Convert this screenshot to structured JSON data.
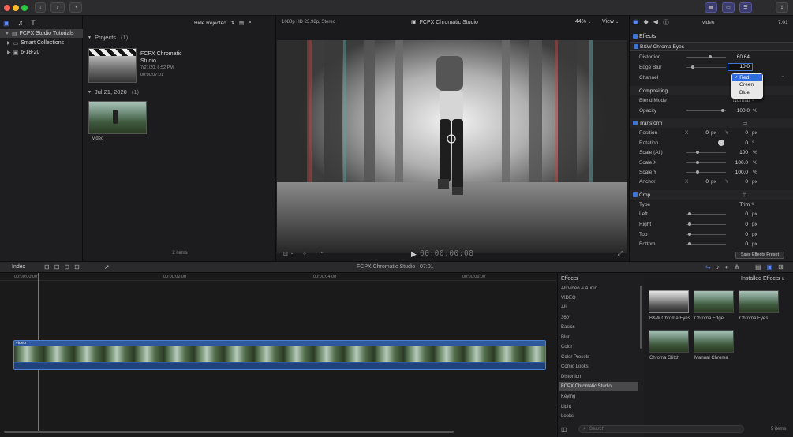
{
  "toolbar": {
    "hide_rejected": "Hide Rejected",
    "format": "1080p HD 23.98p, Stereo",
    "project_name": "FCPX Chromatic Studio",
    "zoom": "44%",
    "view": "View",
    "clip_name": "video",
    "timecode": "7:01"
  },
  "library": {
    "items": [
      {
        "label": "FCPX Studio Tutorials"
      },
      {
        "label": "Smart Collections"
      },
      {
        "label": "6-18-20"
      }
    ]
  },
  "browser": {
    "projects_label": "Projects",
    "projects_count": "(1)",
    "project": {
      "title": "FCPX Chromatic Studio",
      "date": "7/21/20, 8:52 PM",
      "duration": "00:00:07:01"
    },
    "date_label": "Jul 21, 2020",
    "date_count": "(1)",
    "clip_label": "video",
    "item_count": "2 items"
  },
  "viewer": {
    "timecode": "00:00:00:08"
  },
  "inspector": {
    "effects_label": "Effects",
    "effect_name": "B&W Chroma Eyes",
    "distortion_label": "Distortion",
    "distortion_value": "60.64",
    "edgeblur_label": "Edge Blur",
    "edgeblur_value": "10.0",
    "channel_label": "Channel",
    "channel_options": [
      "Red",
      "Green",
      "Blue"
    ],
    "compositing_label": "Compositing",
    "blendmode_label": "Blend Mode",
    "blendmode_value": "Normal",
    "opacity_label": "Opacity",
    "opacity_value": "100.0",
    "pct": "%",
    "transform_label": "Transform",
    "position_label": "Position",
    "x": "X",
    "y": "Y",
    "px": "px",
    "zero": "0",
    "rotation_label": "Rotation",
    "rotation_value": "0",
    "deg": "°",
    "scaleall_label": "Scale (All)",
    "scalex_label": "Scale X",
    "scaley_label": "Scale Y",
    "hundred": "100",
    "anchor_label": "Anchor",
    "crop_label": "Crop",
    "type_label": "Type",
    "type_value": "Trim",
    "left_label": "Left",
    "right_label": "Right",
    "top_label": "Top",
    "bottom_label": "Bottom",
    "save_preset": "Save Effects Preset"
  },
  "timeline": {
    "index": "Index",
    "project": "FCPX Chromatic Studio",
    "duration": "07:01",
    "ticks": [
      "00:00:00:00",
      "00:00:02:00",
      "00:00:04:00",
      "00:00:06:00"
    ],
    "clip_label": "video"
  },
  "effects": {
    "title": "Effects",
    "installed": "Installed Effects",
    "categories": [
      "All Video & Audio",
      "VIDEO",
      "All",
      "360°",
      "Basics",
      "Blur",
      "Color",
      "Color Presets",
      "Comic Looks",
      "Distortion",
      "FCPX Chromatic Studio",
      "Keying",
      "Light",
      "Looks"
    ],
    "thumbs": [
      "B&W Chroma Eyes",
      "Chroma Edge",
      "Chroma Eyes",
      "Chroma Glitch",
      "Manual Chroma"
    ],
    "search_placeholder": "Search",
    "count": "5 items"
  },
  "colors": {
    "accent": "#3d74d6",
    "selected_effect_category": "#49494c"
  }
}
